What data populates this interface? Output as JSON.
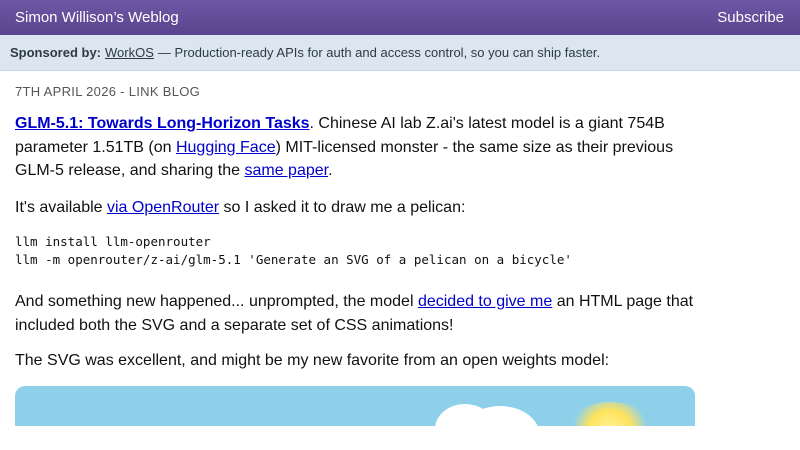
{
  "header": {
    "site_title": "Simon Willison’s Weblog",
    "subscribe_label": "Subscribe"
  },
  "sponsor": {
    "label": "Sponsored by:",
    "name": "WorkOS",
    "text": "— Production-ready APIs for auth and access control, so you can ship faster."
  },
  "post": {
    "dateline": "7TH APRIL 2026 - LINK BLOG",
    "title_link": "GLM-5.1: Towards Long-Horizon Tasks",
    "p1_a": ". Chinese AI lab Z.ai's latest model is a giant 754B parameter 1.51TB (on ",
    "p1_link1": "Hugging Face",
    "p1_b": ") MIT-licensed monster - the same size as their previous GLM-5 release, and sharing the ",
    "p1_link2": "same paper",
    "p1_c": ".",
    "p2_a": "It's available ",
    "p2_link": "via OpenRouter",
    "p2_b": " so I asked it to draw me a pelican:",
    "code_line1": "llm install llm-openrouter",
    "code_line2": "llm -m openrouter/z-ai/glm-5.1 'Generate an SVG of a pelican on a bicycle'",
    "p3_a": "And something new happened... unprompted, the model ",
    "p3_link": "decided to give me",
    "p3_b": " an HTML page that included both the SVG and a separate set of CSS animations!",
    "p4": "The SVG was excellent, and might be my new favorite from an open weights model:"
  },
  "colors": {
    "header_bg": "#5f4a95",
    "sponsor_bg": "#dbe6f1",
    "link": "#0000cc",
    "sky": "#8ed0ea"
  }
}
